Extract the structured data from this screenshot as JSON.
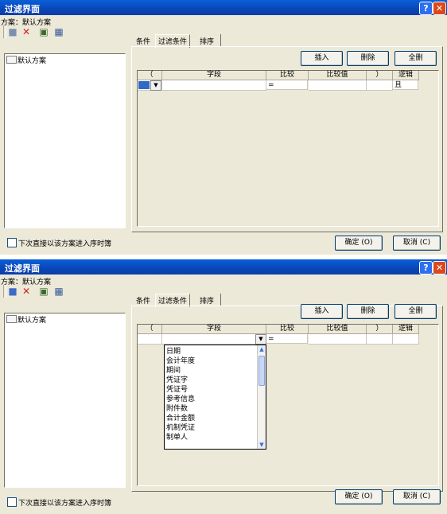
{
  "window_title": "过滤界面",
  "title_buttons": {
    "help": "?",
    "close": "✕"
  },
  "scheme_label": "方案：默认方案",
  "toolbar_icons": [
    "save-icon",
    "delete-icon",
    "copy-icon",
    "table-icon"
  ],
  "tree_item": "默认方案",
  "tabs": [
    "条件",
    "过滤条件",
    "排序"
  ],
  "active_tab": "过滤条件",
  "buttons": {
    "insert": "插入",
    "delete": "删除",
    "clear_all": "全删"
  },
  "columns": [
    "（",
    "字段",
    "比较",
    "比较值",
    "）",
    "逻辑"
  ],
  "row": {
    "paren_open": "",
    "field": "",
    "compare": "=",
    "value": "",
    "paren_close": "",
    "logic": "且"
  },
  "checkbox_label": "下次直接以该方案进入序时簿",
  "confirm_button": "确定 (O)",
  "cancel_button": "取消 (C)",
  "field_options": [
    "日期",
    "会计年度",
    "期间",
    "凭证字",
    "凭证号",
    "参考信息",
    "附件数",
    "合计金额",
    "机制凭证",
    "制单人"
  ],
  "colors": {
    "title_bar": "#0a46b7",
    "dialog_bg": "#ece9d8",
    "close_button": "#d8491e",
    "selection": "#316ac5"
  }
}
